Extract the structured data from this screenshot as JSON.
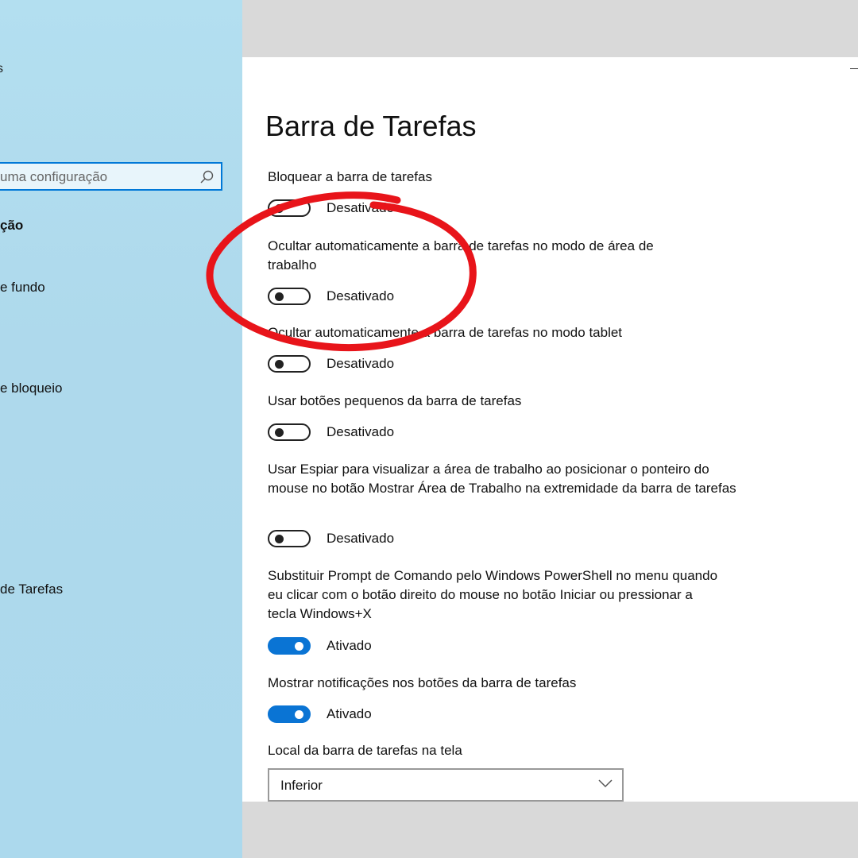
{
  "sidebar": {
    "title_fragment": "s",
    "search_placeholder": "uma configuração",
    "heading": "ção",
    "items": [
      {
        "label": "e fundo"
      },
      {
        "label": "e bloqueio"
      },
      {
        "label": "de Tarefas"
      }
    ]
  },
  "page": {
    "title": "Barra de Tarefas"
  },
  "settings": [
    {
      "label": "Bloquear a barra de tarefas",
      "state": "Desativado",
      "on": false
    },
    {
      "label": "Ocultar automaticamente a barra de tarefas no modo de área de trabalho",
      "state": "Desativado",
      "on": false
    },
    {
      "label": "Ocultar automaticamente a barra de tarefas no modo tablet",
      "state": "Desativado",
      "on": false
    },
    {
      "label": "Usar botões pequenos da barra de tarefas",
      "state": "Desativado",
      "on": false
    },
    {
      "label": "Usar Espiar para visualizar a área de trabalho ao posicionar o ponteiro do mouse no botão Mostrar Área de Trabalho na extremidade da barra de tarefas",
      "state": "Desativado",
      "on": false
    },
    {
      "label": "Substituir Prompt de Comando pelo Windows PowerShell no menu quando eu clicar com o botão direito do mouse no botão Iniciar ou pressionar a tecla Windows+X",
      "state": "Ativado",
      "on": true
    },
    {
      "label": "Mostrar notificações nos botões da barra de tarefas",
      "state": "Ativado",
      "on": true
    }
  ],
  "location": {
    "label": "Local da barra de tarefas na tela",
    "value": "Inferior"
  },
  "colors": {
    "accent": "#0a74d4",
    "sidebar_bg": "#aed9ec",
    "annotation": "#e8141a"
  },
  "icons": [
    "search-icon",
    "chevron-down-icon",
    "minimize-icon"
  ]
}
